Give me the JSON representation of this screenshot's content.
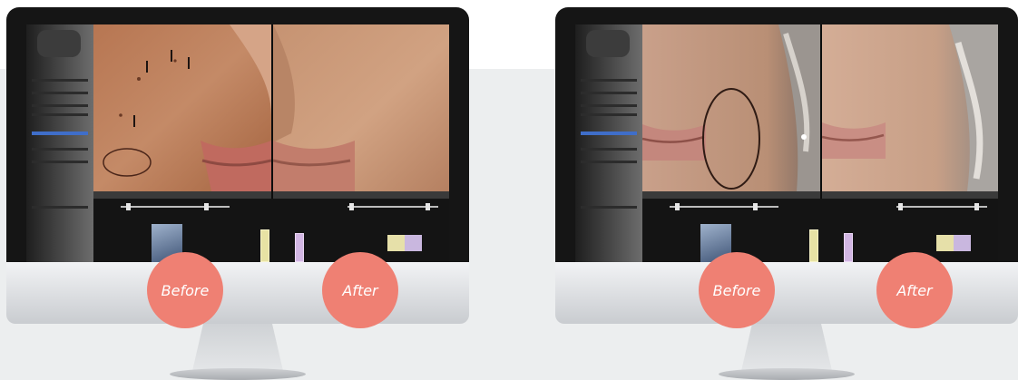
{
  "comparisons": [
    {
      "before_label": "Before",
      "after_label": "After"
    },
    {
      "before_label": "Before",
      "after_label": "After"
    }
  ],
  "colors": {
    "badge": "#ef8073",
    "monitor_frame": "#151515",
    "background_band": "#eceeef",
    "sidebar_highlight": "#3f6ec9",
    "level_yellow": "#e7e2a4",
    "level_purple": "#d2b6e3"
  }
}
